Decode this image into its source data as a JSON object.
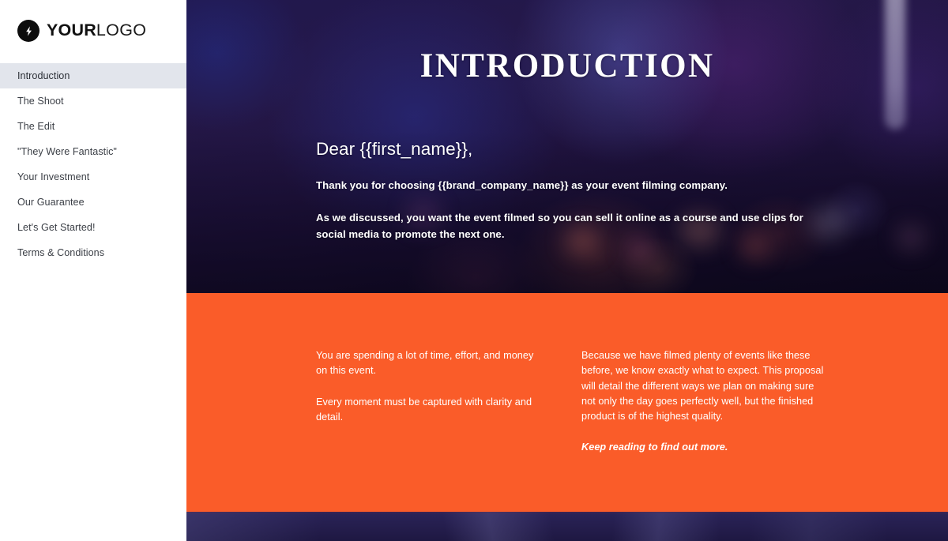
{
  "brand": {
    "logo_icon": "lightning-bolt-icon",
    "name_bold": "YOUR",
    "name_light": "LOGO"
  },
  "sidebar": {
    "items": [
      {
        "label": "Introduction",
        "active": true
      },
      {
        "label": "The Shoot",
        "active": false
      },
      {
        "label": "The Edit",
        "active": false
      },
      {
        "label": "\"They Were Fantastic\"",
        "active": false
      },
      {
        "label": "Your Investment",
        "active": false
      },
      {
        "label": "Our Guarantee",
        "active": false
      },
      {
        "label": "Let's Get Started!",
        "active": false
      },
      {
        "label": "Terms & Conditions",
        "active": false
      }
    ]
  },
  "hero": {
    "title": "INTRODUCTION",
    "greeting": "Dear {{first_name}},",
    "paragraph_1": "Thank you for choosing {{brand_company_name}} as your event filming company.",
    "paragraph_2": "As we discussed, you want the event filmed so you can sell it online as a course and use clips for social media to promote the next one."
  },
  "orange_section": {
    "left_paragraph_1": "You are spending a lot of time, effort, and money on this event.",
    "left_paragraph_2": "Every moment must be captured with clarity and detail.",
    "right_paragraph_1": "Because we have filmed plenty of events like these before, we know exactly what to expect. This proposal will detail the different ways we plan on making sure not only the day goes perfectly well, but the finished product is of the highest quality.",
    "right_paragraph_2": "Keep reading to find out more."
  },
  "colors": {
    "accent_orange": "#fa5c29",
    "sidebar_active": "#e2e5ec",
    "hero_dark": "#17102b",
    "text_dark": "#3b3f46",
    "white": "#ffffff"
  }
}
